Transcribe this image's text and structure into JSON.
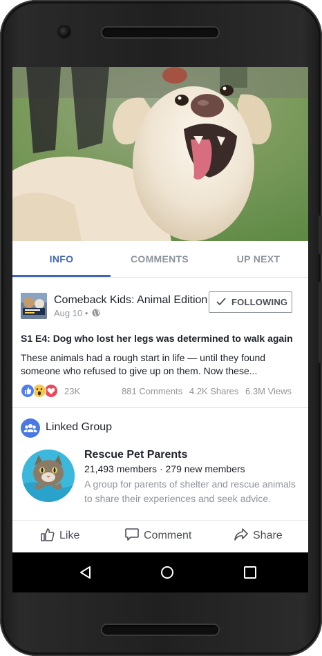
{
  "video": {
    "image_description": "White dog with tongue out on grass"
  },
  "tabs": [
    {
      "label": "INFO",
      "active": true
    },
    {
      "label": "COMMENTS",
      "active": false
    },
    {
      "label": "UP NEXT",
      "active": false
    }
  ],
  "page": {
    "name": "Comeback Kids: Animal Edition",
    "date": "Aug 10 •",
    "privacy_icon": "globe-icon",
    "follow_label": "FOLLOWING"
  },
  "post": {
    "title": "S1 E4: Dog who lost her legs was determined to walk again",
    "description": "These animals had a rough start in life — until they found someone who refused to give up on them. Now these..."
  },
  "engagement": {
    "reactions": [
      "like",
      "wow",
      "love"
    ],
    "reaction_count": "23K",
    "comments": "881 Comments",
    "shares": "4.2K Shares",
    "views": "6.3M Views"
  },
  "linked_group": {
    "section_title": "Linked Group",
    "name": "Rescue Pet Parents",
    "members": "21,493 members · 279 new members",
    "description": "A group for parents of shelter and rescue animals to share their experiences and seek advice."
  },
  "actions": {
    "like": "Like",
    "comment": "Comment",
    "share": "Share"
  },
  "colors": {
    "accent": "#4267b2",
    "muted": "#90949c",
    "text": "#1d2129"
  }
}
